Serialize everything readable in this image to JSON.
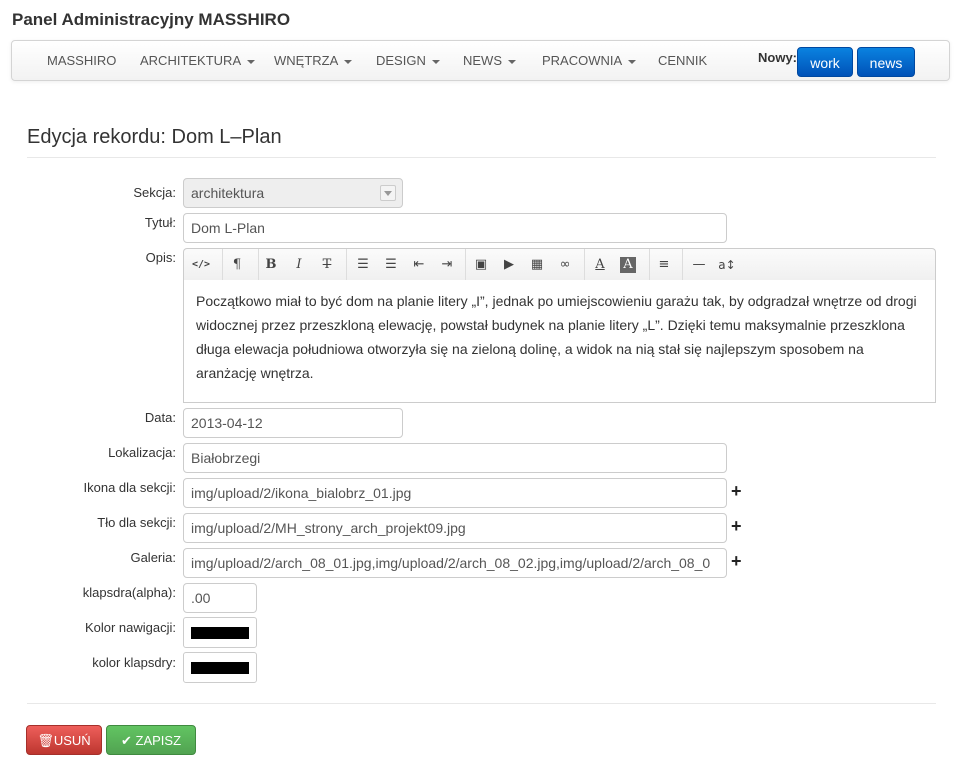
{
  "app": {
    "title": "Panel Administracyjny MASSHIRO"
  },
  "nav": {
    "items": [
      {
        "label": "MASSHIRO",
        "dropdown": false
      },
      {
        "label": "ARCHITEKTURA",
        "dropdown": true
      },
      {
        "label": "WNĘTRZA",
        "dropdown": true
      },
      {
        "label": "DESIGN",
        "dropdown": true
      },
      {
        "label": "NEWS",
        "dropdown": true
      },
      {
        "label": "PRACOWNIA",
        "dropdown": true
      },
      {
        "label": "CENNIK",
        "dropdown": false
      }
    ],
    "new_label": "Nowy:",
    "new_buttons": [
      "work",
      "news"
    ],
    "button_color": "#0061c9"
  },
  "page": {
    "heading": "Edycja rekordu: Dom L–Plan"
  },
  "form": {
    "sekcja": {
      "label": "Sekcja:",
      "value": "architektura"
    },
    "tytul": {
      "label": "Tytuł:",
      "value": "Dom L-Plan"
    },
    "opis": {
      "label": "Opis:",
      "text": "Początkowo miał to być dom na planie litery „I”, jednak po umiejscowieniu garażu tak, by odgradzał wnętrze od drogi widocznej przez przeszkloną elewację, powstał budynek na planie litery „L”. Dzięki temu maksymalnie przeszklona długa elewacja południowa otworzyła się na zieloną dolinę, a widok na nią stał się najlepszym sposobem na aranżację wnętrza."
    },
    "data": {
      "label": "Data:",
      "value": "2013-04-12"
    },
    "lokalizacja": {
      "label": "Lokalizacja:",
      "value": "Białobrzegi"
    },
    "ikona": {
      "label": "Ikona dla sekcji:",
      "value": "img/upload/2/ikona_bialobrz_01.jpg"
    },
    "tlo": {
      "label": "Tło dla sekcji:",
      "value": "img/upload/2/MH_strony_arch_projekt09.jpg"
    },
    "galeria": {
      "label": "Galeria:",
      "value": "img/upload/2/arch_08_01.jpg,img/upload/2/arch_08_02.jpg,img/upload/2/arch_08_0"
    },
    "alpha": {
      "label": "klapsdra(alpha):",
      "value": ".00"
    },
    "kolor_nawigacji": {
      "label": "Kolor nawigacji:",
      "color": "#000000"
    },
    "kolor_klapsdry": {
      "label": "kolor klapsdry:",
      "color": "#000000"
    }
  },
  "toolbar": {
    "icons": [
      "code-view-icon",
      "paragraph-icon",
      "bold-icon",
      "italic-icon",
      "strikethrough-icon",
      "unordered-list-icon",
      "ordered-list-icon",
      "outdent-icon",
      "indent-icon",
      "image-icon",
      "video-icon",
      "table-icon",
      "link-icon",
      "font-color-icon",
      "background-color-icon",
      "align-icon",
      "horizontal-rule-icon",
      "font-size-icon"
    ]
  },
  "actions": {
    "delete_label": "USUŃ",
    "save_label": "ZAPISZ",
    "delete_color": "#d9534f",
    "save_color": "#5cb85c"
  }
}
